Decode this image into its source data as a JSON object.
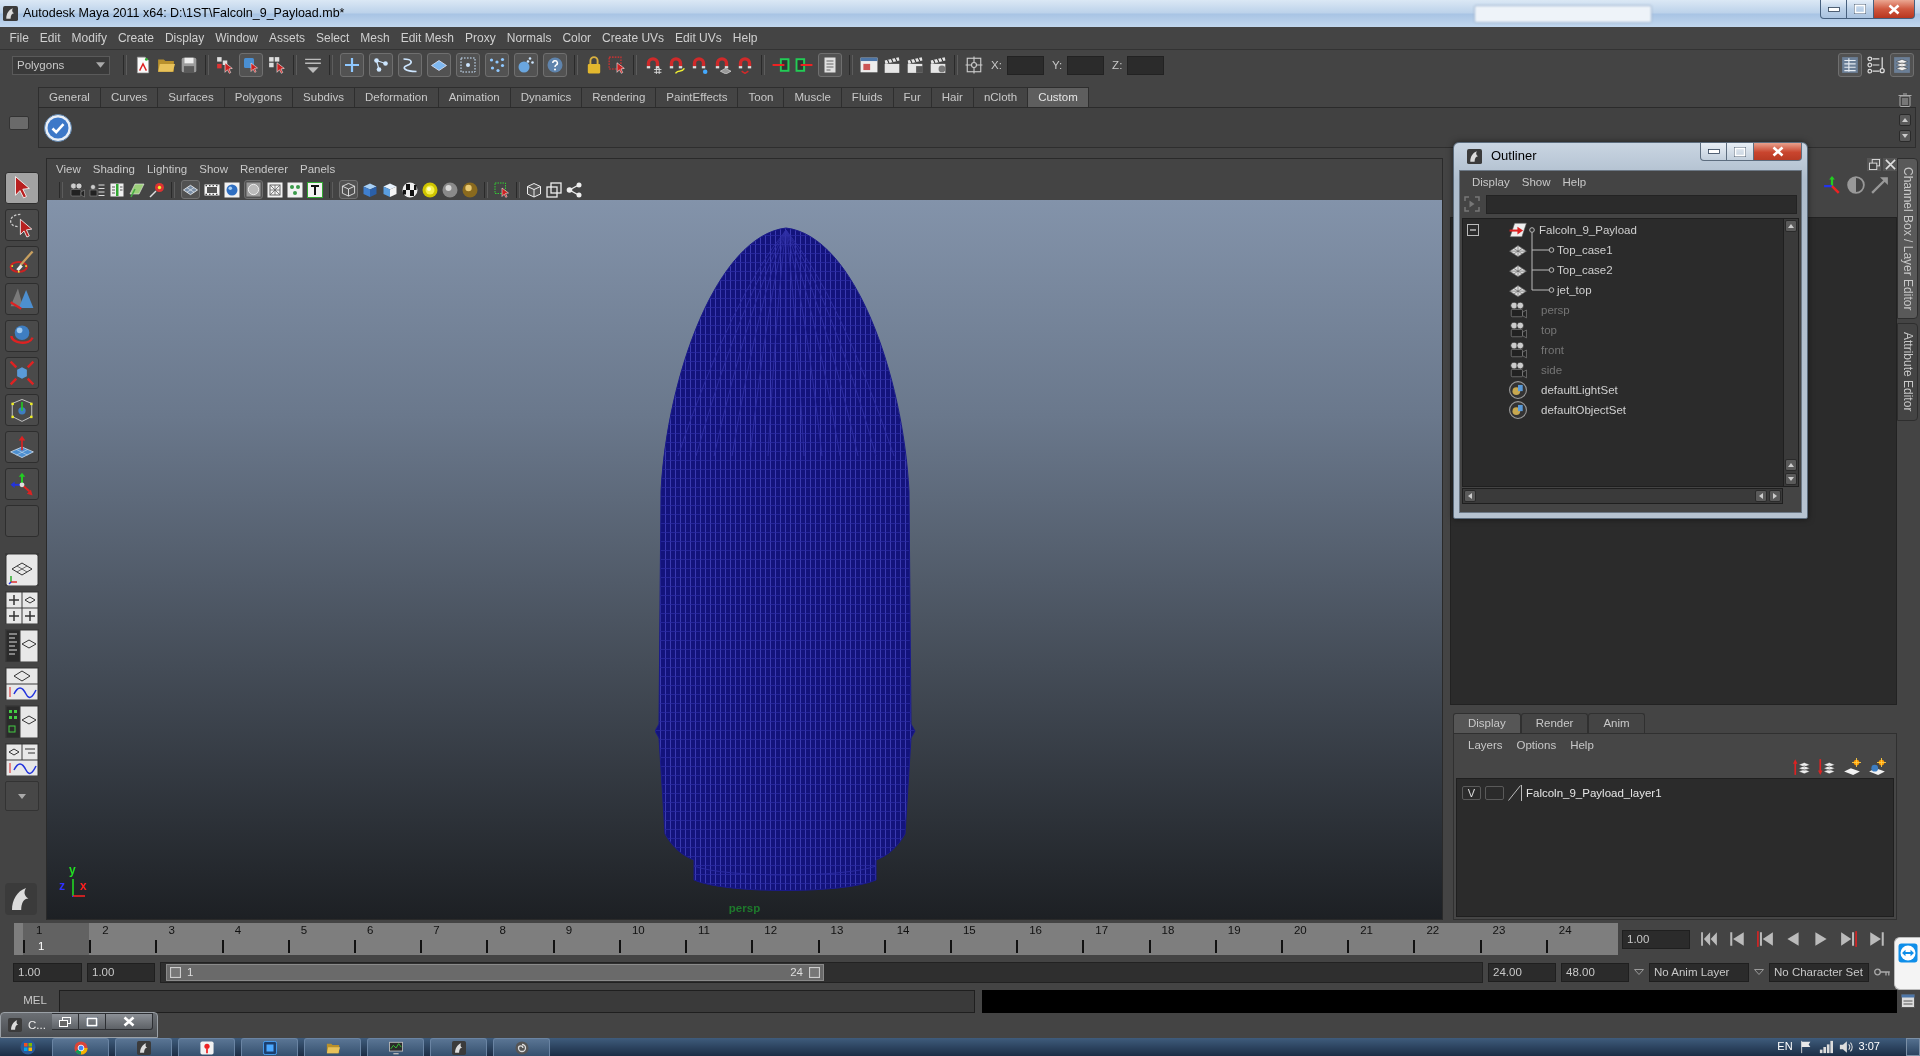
{
  "title_bar": {
    "title": "Autodesk Maya 2011 x64: D:\\1ST\\Falcoln_9_Payload.mb*"
  },
  "menu_bar": [
    "File",
    "Edit",
    "Modify",
    "Create",
    "Display",
    "Window",
    "Assets",
    "Select",
    "Mesh",
    "Edit Mesh",
    "Proxy",
    "Normals",
    "Color",
    "Create UVs",
    "Edit UVs",
    "Help"
  ],
  "status_line": {
    "menu_set": "Polygons",
    "coordinates": [
      "X:",
      "Y:",
      "Z:"
    ]
  },
  "shelf": {
    "tabs": [
      {
        "label": "General",
        "selected": false
      },
      {
        "label": "Curves",
        "selected": false
      },
      {
        "label": "Surfaces",
        "selected": false
      },
      {
        "label": "Polygons",
        "selected": false
      },
      {
        "label": "Subdivs",
        "selected": false
      },
      {
        "label": "Deformation",
        "selected": false
      },
      {
        "label": "Animation",
        "selected": false
      },
      {
        "label": "Dynamics",
        "selected": false
      },
      {
        "label": "Rendering",
        "selected": false
      },
      {
        "label": "PaintEffects",
        "selected": false
      },
      {
        "label": "Toon",
        "selected": false
      },
      {
        "label": "Muscle",
        "selected": false
      },
      {
        "label": "Fluids",
        "selected": false
      },
      {
        "label": "Fur",
        "selected": false
      },
      {
        "label": "Hair",
        "selected": false
      },
      {
        "label": "nCloth",
        "selected": false
      },
      {
        "label": "Custom",
        "selected": true
      }
    ]
  },
  "toolbox": {
    "tools": [
      {
        "selected": true
      },
      {
        "selected": false
      },
      {
        "selected": false
      },
      {
        "selected": false
      },
      {
        "selected": false
      },
      {
        "selected": false
      },
      {
        "selected": false
      },
      {
        "selected": false
      },
      {
        "selected": false
      },
      {
        "selected": false
      }
    ]
  },
  "viewport": {
    "menu": [
      "View",
      "Shading",
      "Lighting",
      "Show",
      "Renderer",
      "Panels"
    ],
    "axes": [
      {
        "label": "y",
        "color": "#22e022"
      },
      {
        "label": "z",
        "color": "#3030ff"
      },
      {
        "label": "x",
        "color": "#ff2020"
      }
    ],
    "camera": "persp"
  },
  "outliner": {
    "title": "Outliner",
    "menu": [
      "Display",
      "Show",
      "Help"
    ],
    "items": [
      {
        "label": "Falcoln_9_Payload",
        "kind": "group",
        "hidden": false,
        "expanded": true,
        "children": [
          {
            "label": "Top_case1",
            "kind": "mesh",
            "hidden": false
          },
          {
            "label": "Top_case2",
            "kind": "mesh",
            "hidden": false
          },
          {
            "label": "jet_top",
            "kind": "mesh",
            "hidden": false
          }
        ]
      },
      {
        "label": "persp",
        "kind": "camera",
        "hidden": true
      },
      {
        "label": "top",
        "kind": "camera",
        "hidden": true
      },
      {
        "label": "front",
        "kind": "camera",
        "hidden": true
      },
      {
        "label": "side",
        "kind": "camera",
        "hidden": true
      },
      {
        "label": "defaultLightSet",
        "kind": "set",
        "hidden": false
      },
      {
        "label": "defaultObjectSet",
        "kind": "set",
        "hidden": false
      }
    ]
  },
  "side_tabs": [
    {
      "label": "Channel Box / Layer Editor",
      "selected": true
    },
    {
      "label": "Attribute Editor",
      "selected": false
    }
  ],
  "layer_editor": {
    "tabs": [
      {
        "label": "Display",
        "selected": true
      },
      {
        "label": "Render",
        "selected": false
      },
      {
        "label": "Anim",
        "selected": false
      }
    ],
    "menu": [
      "Layers",
      "Options",
      "Help"
    ],
    "layers": [
      {
        "visibility": "V",
        "name": "Falcoln_9_Payload_layer1"
      }
    ]
  },
  "time_slider": {
    "frames": [
      {
        "label": "1",
        "selected": true
      },
      {
        "label": "2",
        "selected": false
      },
      {
        "label": "3",
        "selected": false
      },
      {
        "label": "4",
        "selected": false
      },
      {
        "label": "5",
        "selected": false
      },
      {
        "label": "6",
        "selected": false
      },
      {
        "label": "7",
        "selected": false
      },
      {
        "label": "8",
        "selected": false
      },
      {
        "label": "9",
        "selected": false
      },
      {
        "label": "10",
        "selected": false
      },
      {
        "label": "11",
        "selected": false
      },
      {
        "label": "12",
        "selected": false
      },
      {
        "label": "13",
        "selected": false
      },
      {
        "label": "14",
        "selected": false
      },
      {
        "label": "15",
        "selected": false
      },
      {
        "label": "16",
        "selected": false
      },
      {
        "label": "17",
        "selected": false
      },
      {
        "label": "18",
        "selected": false
      },
      {
        "label": "19",
        "selected": false
      },
      {
        "label": "20",
        "selected": false
      },
      {
        "label": "21",
        "selected": false
      },
      {
        "label": "22",
        "selected": false
      },
      {
        "label": "23",
        "selected": false
      },
      {
        "label": "24",
        "selected": false
      }
    ],
    "current_frame": "1",
    "current_time": "1.00"
  },
  "range_slider": {
    "start_time": "1.00",
    "playback_start": "1.00",
    "range_start": "1",
    "range_end": "24",
    "level": 0.5,
    "playback_end": "24.00",
    "end_time": "48.00",
    "anim_layer": "No Anim Layer",
    "character_set": "No Character Set"
  },
  "command_line": {
    "language": "MEL"
  },
  "minimized_window": {
    "title": "C..."
  },
  "taskbar": {
    "language": "EN",
    "clock": "3:07"
  }
}
